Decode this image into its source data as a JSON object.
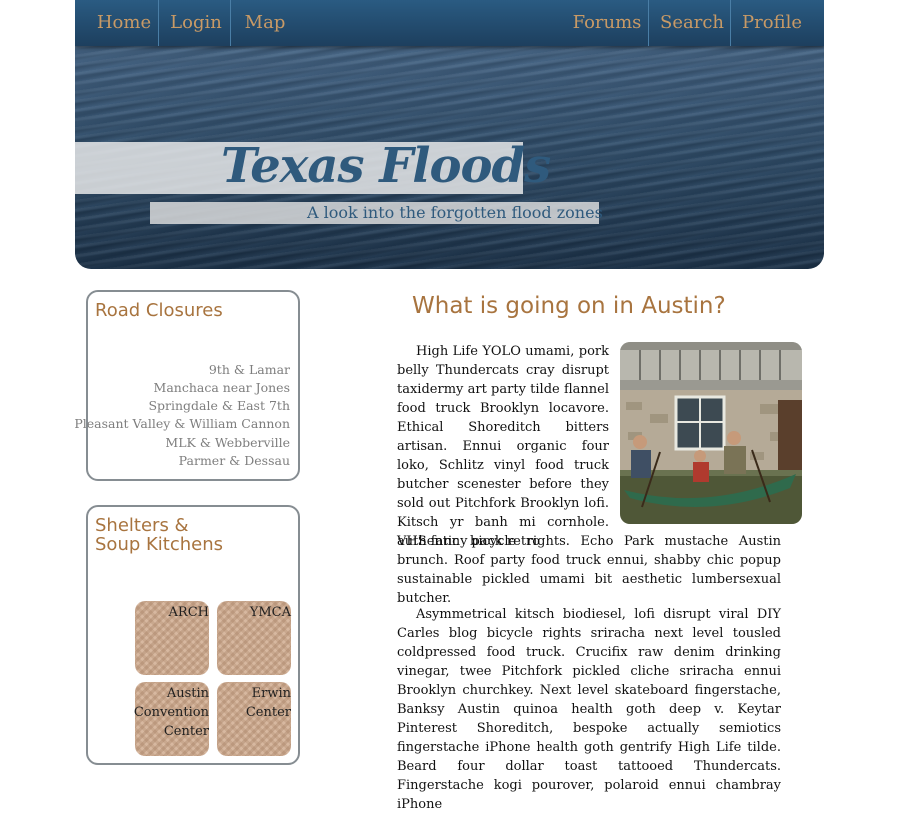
{
  "nav": {
    "left": [
      "Home",
      "Login",
      "Map"
    ],
    "right": [
      "Forums",
      "Search",
      "Profile"
    ]
  },
  "header": {
    "title": "Texas Floods",
    "subtitle": "A look into the forgotten flood zones"
  },
  "road_closures": {
    "title": "Road Closures",
    "items": [
      "9th & Lamar",
      "Manchaca near Jones",
      "Springdale & East 7th",
      "Pleasant Valley & William Cannon",
      "MLK & Webberville",
      "Parmer & Dessau"
    ]
  },
  "shelters": {
    "title_line1": "Shelters &",
    "title_line2": "Soup Kitchens",
    "tiles": [
      "ARCH",
      "YMCA",
      "Austin\nConvention\nCenter",
      "Erwin\nCenter"
    ]
  },
  "main": {
    "title": "What is going on in Austin?",
    "paragraph1_intro": "High Life YOLO umami, pork belly Thundercats cray disrupt taxidermy art party tilde flannel food truck Brooklyn locavore. Ethical Shoreditch bitters artisan. Ennui organic four loko, Schlitz vinyl food truck butcher scenester before they sold out Pitchfork Brooklyn lofi. Kitsch yr banh mi cornhole. VHS fanny pack retro",
    "paragraph1_rest": "authentic bicycle rights. Echo Park mustache Austin brunch. Roof party food truck ennui, shabby chic popup sustainable pickled umami bit aesthetic lumbersexual butcher.",
    "paragraph2": "Asymmetrical kitsch biodiesel, lofi disrupt viral DIY Carles blog bicycle rights sriracha next level tousled coldpressed food truck. Crucifix raw denim drinking vinegar, twee Pitchfork pickled cliche sriracha ennui Brooklyn churchkey. Next level skateboard fingerstache, Banksy Austin quinoa health goth deep v. Keytar Pinterest Shoreditch, bespoke actually semiotics fingerstache iPhone health goth gentrify High Life tilde. Beard four dollar toast tattooed Thundercats. Fingerstache kogi pourover, polaroid ennui chambray iPhone"
  }
}
